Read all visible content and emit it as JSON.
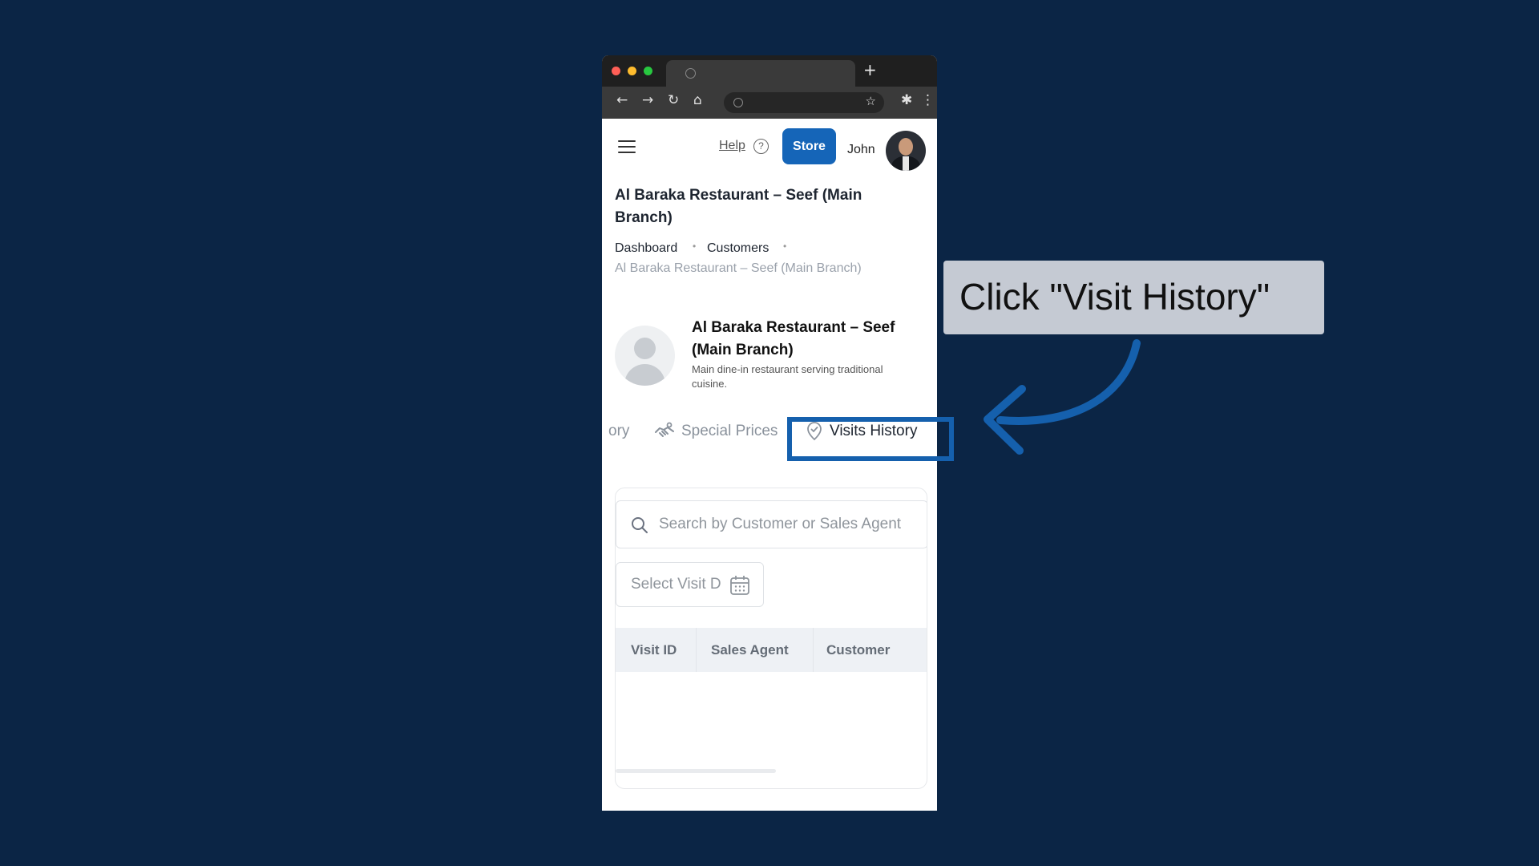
{
  "browser": {
    "new_tab_label": "+",
    "nav": {
      "back": "←",
      "forward": "→",
      "reload": "↻",
      "home": "⌂",
      "bookmark": "☆",
      "extensions": "✱",
      "menu": "⋮"
    }
  },
  "header": {
    "help_label": "Help",
    "help_icon": "?",
    "store_label": "Store",
    "user_name": "John"
  },
  "page_title": "Al Baraka Restaurant – Seef (Main Branch)",
  "breadcrumb": {
    "items": [
      "Dashboard",
      "Customers"
    ],
    "separator": "•",
    "current": "Al Baraka Restaurant – Seef (Main Branch)"
  },
  "profile": {
    "name": "Al Baraka Restaurant – Seef (Main Branch)",
    "description": "Main dine-in restaurant serving traditional cuisine."
  },
  "tabs": [
    {
      "label": "ory",
      "icon": "partial-tab"
    },
    {
      "label": "Special Prices",
      "icon": "handshake-icon"
    },
    {
      "label": "Visits History",
      "icon": "location-check-icon",
      "active": true
    }
  ],
  "visits": {
    "search_placeholder": "Search by Customer or Sales Agent",
    "date_placeholder": "Select Visit Date",
    "columns": [
      "Visit ID",
      "Sales Agent",
      "Customer"
    ]
  },
  "annotation": {
    "callout_text": "Click \"Visit History\"",
    "accent_color": "#1560ad"
  },
  "colors": {
    "background": "#0b2545",
    "primary_button": "#1565b8"
  }
}
